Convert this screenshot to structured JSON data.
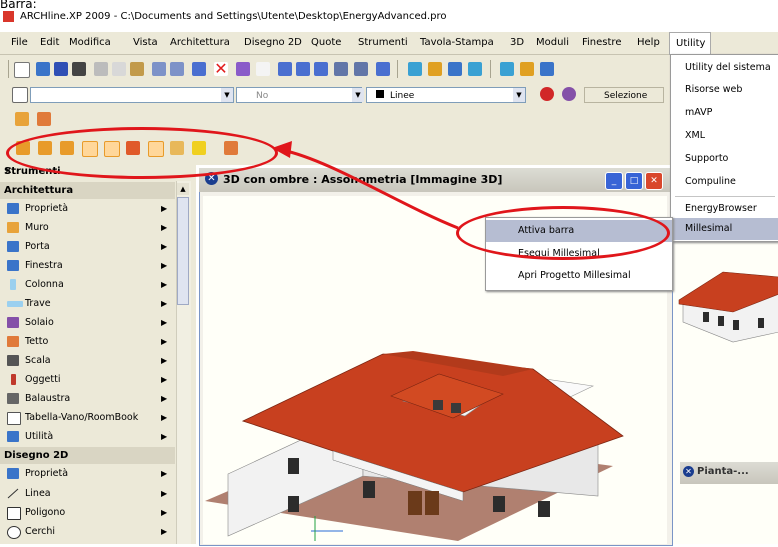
{
  "top_crop_text": "Barra:",
  "window": {
    "title": "ARCHline.XP 2009 - C:\\Documents and Settings\\Utente\\Desktop\\EnergyAdvanced.pro"
  },
  "menubar": [
    "File",
    "Edit",
    "Modifica",
    "Vista",
    "Architettura",
    "Disegno 2D",
    "Quote",
    "Strumenti",
    "Tavola-Stampa",
    "3D",
    "Moduli",
    "Finestre",
    "Help"
  ],
  "menu_utility": "Utility",
  "toolbar2": {
    "layer_value": "No",
    "linetype_value": "Linee",
    "selection_label": "Selezione"
  },
  "panel": {
    "title": "Strumenti",
    "sections": [
      {
        "name": "Architettura",
        "items": [
          "Proprietà",
          "Muro",
          "Porta",
          "Finestra",
          "Colonna",
          "Trave",
          "Solaio",
          "Tetto",
          "Scala",
          "Oggetti",
          "Balaustra",
          "Tabella-Vano/RoomBook",
          "Utilità"
        ]
      },
      {
        "name": "Disegno 2D",
        "items": [
          "Proprietà",
          "Linea",
          "Poligono",
          "Cerchi"
        ]
      }
    ]
  },
  "view3d": {
    "title": "3D con ombre : Assonometria [Immagine 3D]"
  },
  "pianta": {
    "title": "Pianta-..."
  },
  "utility_dropdown": [
    "Utility del sistema",
    "Risorse web",
    "mAVP",
    "XML",
    "Supporto",
    "Compuline",
    "EnergyBrowser",
    "Millesimal"
  ],
  "millesimal_submenu": [
    "Attiva barra",
    "Esegui Millesimal",
    "Apri Progetto Millesimal"
  ],
  "colors": {
    "annotation_red": "#e0161b",
    "menu_highlight": "#b6bdd2",
    "xp_face": "#ece9d8",
    "roof_red": "#c8401f"
  }
}
